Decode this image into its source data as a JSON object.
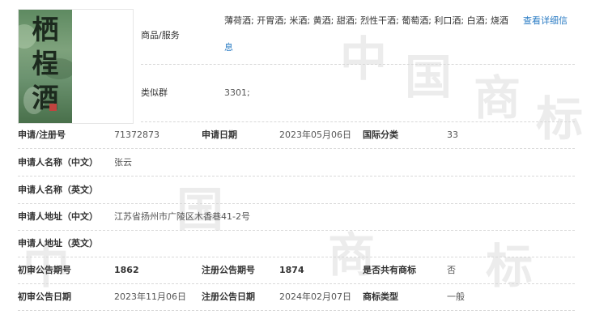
{
  "watermark": {
    "chars": [
      "中",
      "国",
      "商",
      "标"
    ]
  },
  "logo": {
    "characters": [
      "栖",
      "桯",
      "酒"
    ],
    "image_colors": {
      "green": "#6f9771",
      "dark": "#1c2a1e",
      "stamp": "#c0443f"
    }
  },
  "goods": {
    "label": "商品/服务",
    "value": "薄荷酒; 开胃酒; 米酒; 黄酒; 甜酒; 烈性干酒; 葡萄酒; 利口酒; 白酒; 烧酒",
    "detail_link_1": "查看详细信",
    "detail_link_2": "息"
  },
  "similar_group": {
    "label": "类似群",
    "value": "3301;"
  },
  "rows": {
    "reg_no": {
      "label": "申请/注册号",
      "value": "71372873"
    },
    "apply_date": {
      "label": "申请日期",
      "value": "2023年05月06日"
    },
    "intl_class": {
      "label": "国际分类",
      "value": "33"
    },
    "applicant_cn": {
      "label": "申请人名称（中文）",
      "value": "张云"
    },
    "applicant_en": {
      "label": "申请人名称（英文）",
      "value": ""
    },
    "address_cn": {
      "label": "申请人地址（中文）",
      "value": "江苏省扬州市广陵区木香巷41-2号"
    },
    "address_en": {
      "label": "申请人地址（英文）",
      "value": ""
    },
    "prelim_no": {
      "label": "初审公告期号",
      "value": "1862"
    },
    "reg_pub_no": {
      "label": "注册公告期号",
      "value": "1874"
    },
    "shared": {
      "label": "是否共有商标",
      "value": "否"
    },
    "prelim_date": {
      "label": "初审公告日期",
      "value": "2023年11月06日"
    },
    "reg_pub_date": {
      "label": "注册公告日期",
      "value": "2024年02月07日"
    },
    "mark_type": {
      "label": "商标类型",
      "value": "一般"
    }
  },
  "colors": {
    "link": "#2b7cc4",
    "divider": "#d9d9d9",
    "watermark": "#ececec"
  }
}
